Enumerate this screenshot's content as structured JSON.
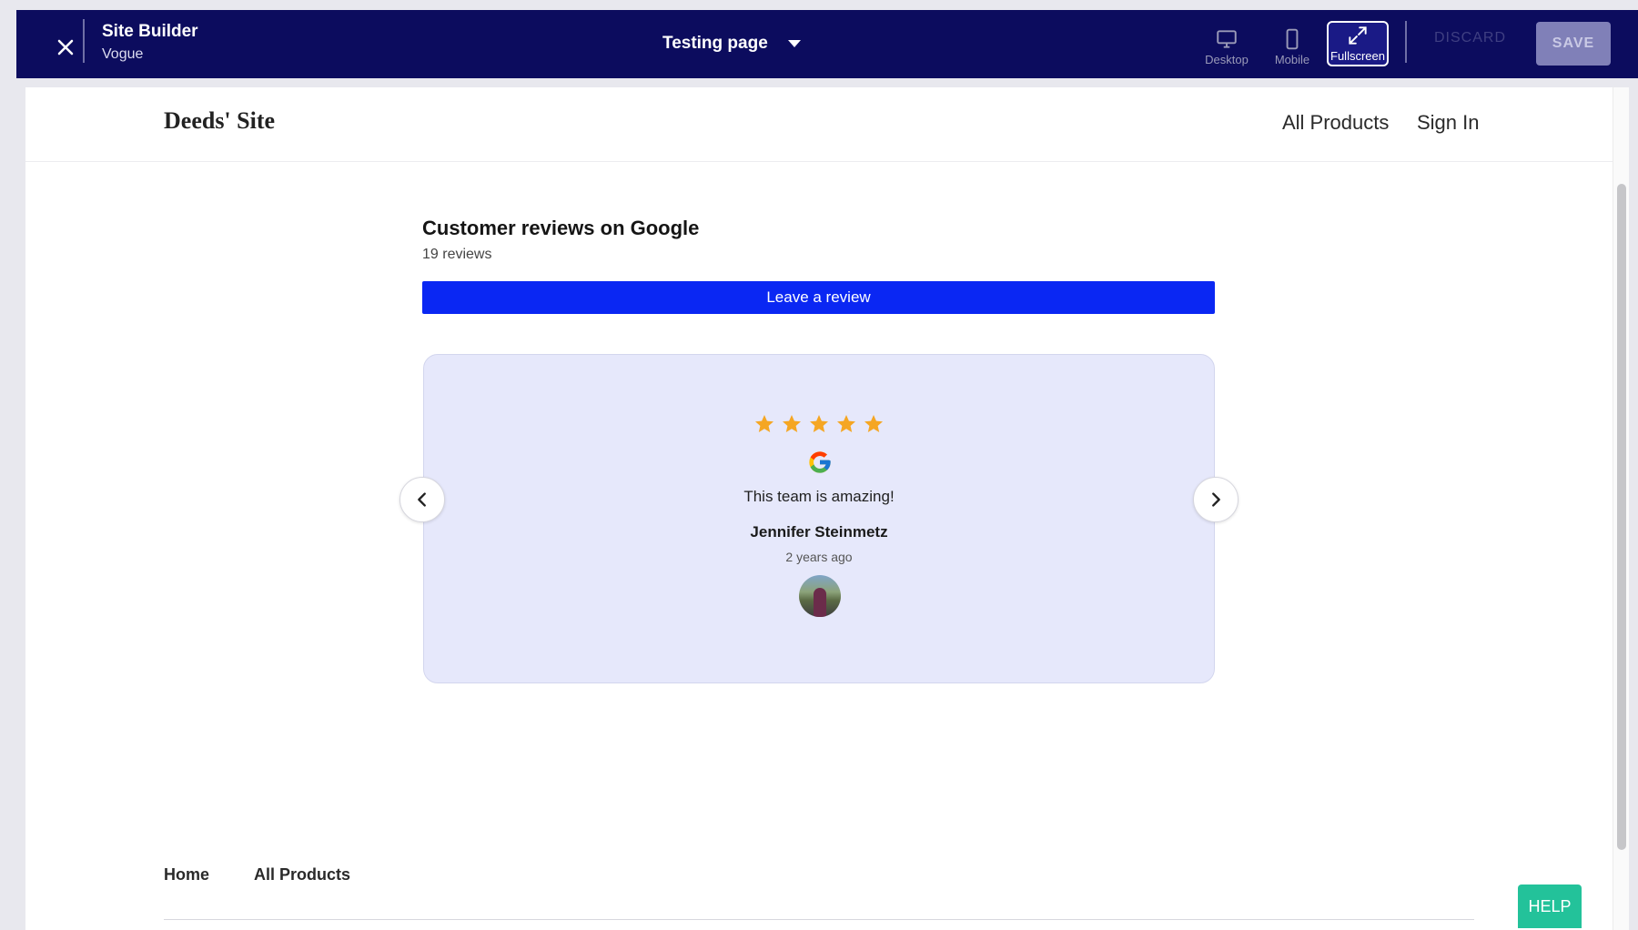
{
  "topbar": {
    "title": "Site Builder",
    "subtitle": "Vogue",
    "page_selector": "Testing page",
    "views": {
      "desktop": "Desktop",
      "mobile": "Mobile",
      "fullscreen": "Fullscreen"
    },
    "active_view": "fullscreen",
    "discard_label": "DISCARD",
    "save_label": "SAVE"
  },
  "site": {
    "brand": "Deeds' Site",
    "nav": [
      "All Products",
      "Sign In"
    ]
  },
  "reviews": {
    "title": "Customer reviews on Google",
    "count_text": "19 reviews",
    "leave_button": "Leave a review",
    "current": {
      "rating": 5,
      "max_rating": 5,
      "source_icon": "google-icon",
      "text": "This team is amazing!",
      "author": "Jennifer Steinmetz",
      "time": "2 years ago"
    }
  },
  "footer": {
    "links": [
      "Home",
      "All Products"
    ]
  },
  "help_label": "HELP",
  "colors": {
    "topbar_bg": "#0c0c5e",
    "primary_button": "#0a27f3",
    "card_bg": "#e6e8fb",
    "star": "#f5a623",
    "help": "#23c29a"
  }
}
